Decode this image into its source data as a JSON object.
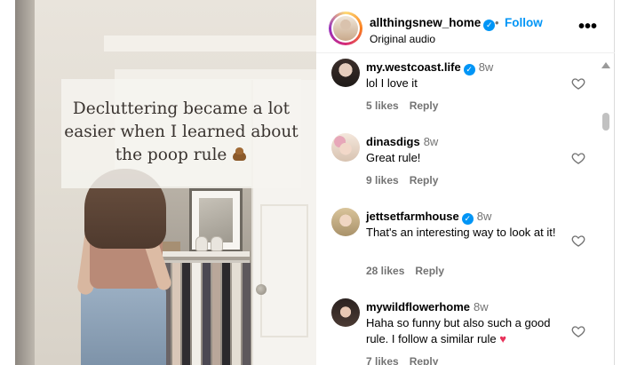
{
  "video": {
    "caption": "Decluttering became a lot easier when I learned about the poop  rule",
    "caption_emoji": "poop-emoji"
  },
  "header": {
    "username": "allthingsnew_home",
    "verified": true,
    "separator": "•",
    "follow_label": "Follow",
    "subtitle": "Original audio",
    "more_icon": "more-horizontal-icon",
    "more_label": "•••"
  },
  "comments": [
    {
      "username": "my.westcoast.life",
      "verified": true,
      "time": "8w",
      "text": "lol I love it",
      "likes": "5 likes",
      "reply_label": "Reply"
    },
    {
      "username": "dinasdigs",
      "verified": false,
      "time": "8w",
      "text": "Great rule!",
      "likes": "9 likes",
      "reply_label": "Reply"
    },
    {
      "username": "jettsetfarmhouse",
      "verified": true,
      "time": "8w",
      "text": "That's an interesting way to look at it!",
      "likes": "28 likes",
      "reply_label": "Reply"
    },
    {
      "username": "mywildflowerhome",
      "verified": false,
      "time": "8w",
      "text": "Haha so funny but also such a good rule. I follow a similar rule",
      "text_emoji": "pink-heart-emoji",
      "likes": "7 likes",
      "reply_label": "Reply"
    }
  ],
  "icons": {
    "like": "heart-outline-icon",
    "verified": "verified-badge-icon"
  },
  "colors": {
    "link_blue": "#0095f6",
    "secondary_text": "#737373",
    "verified_blue": "#0095f6",
    "heart_pink": "#e8325a"
  }
}
